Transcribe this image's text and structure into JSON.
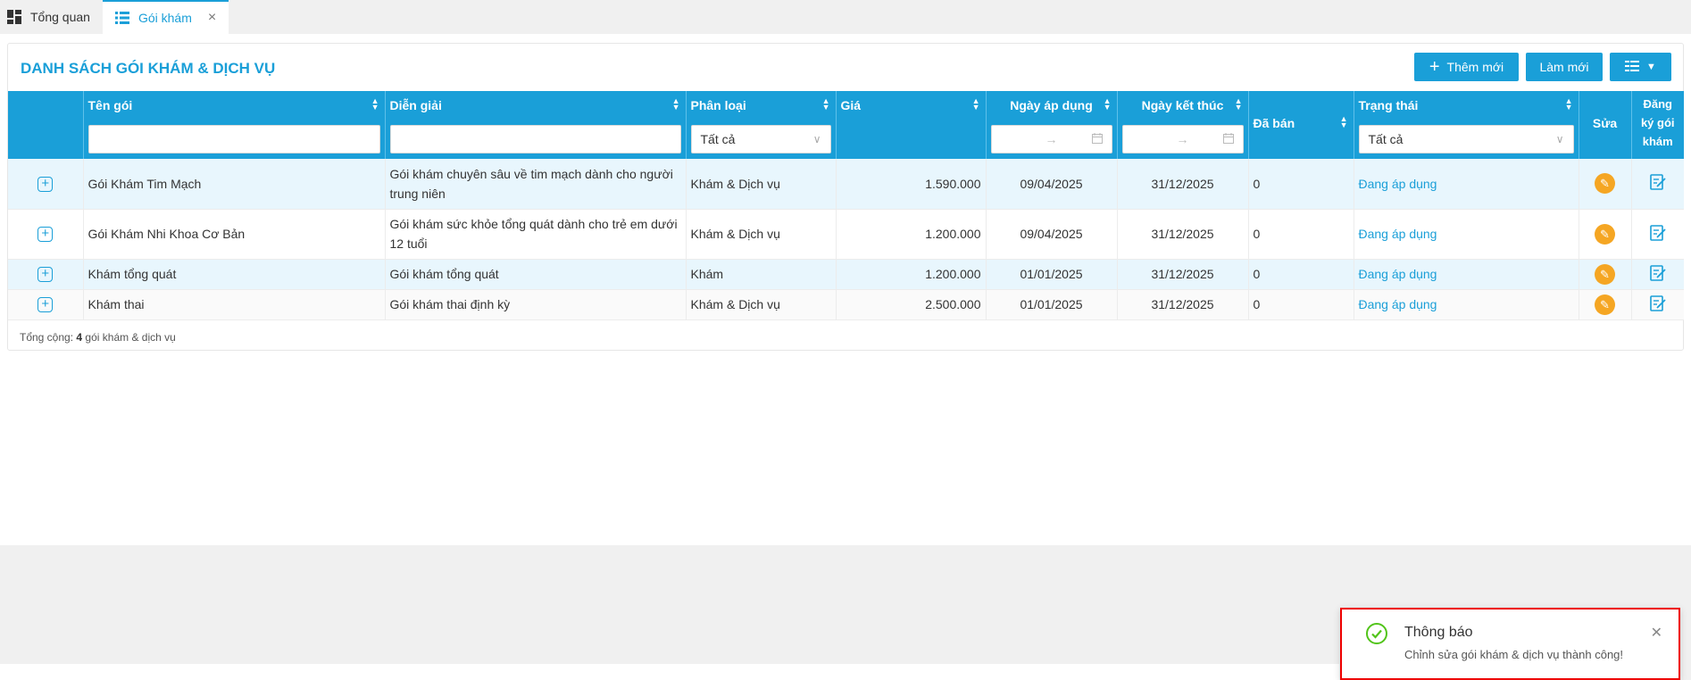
{
  "tabs": [
    {
      "label": "Tổng quan"
    },
    {
      "label": "Gói khám"
    }
  ],
  "card": {
    "title": "DANH SÁCH GÓI KHÁM & DỊCH VỤ",
    "add_label": "Thêm mới",
    "refresh_label": "Làm mới"
  },
  "table": {
    "headers": {
      "name": "Tên gói",
      "desc": "Diễn giải",
      "category": "Phân loại",
      "price": "Giá",
      "start": "Ngày áp dụng",
      "end": "Ngày kết thúc",
      "sold": "Đã bán",
      "status": "Trạng thái",
      "edit": "Sửa",
      "register_1": "Đăng",
      "register_2": "ký gói",
      "register_3": "khám"
    },
    "filters": {
      "category_value": "Tất cả",
      "status_value": "Tất cả",
      "date_sep": "→"
    },
    "rows": [
      {
        "name": "Gói Khám Tim Mạch",
        "desc_1": "Gói khám chuyên sâu về tim mạch dành cho người",
        "desc_2": "trung niên",
        "category": "Khám & Dịch vụ",
        "price": "1.590.000",
        "start": "09/04/2025",
        "end": "31/12/2025",
        "sold": "0",
        "status": "Đang áp dụng"
      },
      {
        "name": "Gói Khám Nhi Khoa Cơ Bản",
        "desc_1": "Gói khám sức khỏe tổng quát dành cho trẻ em dưới",
        "desc_2": "12 tuổi",
        "category": "Khám & Dịch vụ",
        "price": "1.200.000",
        "start": "09/04/2025",
        "end": "31/12/2025",
        "sold": "0",
        "status": "Đang áp dụng"
      },
      {
        "name": "Khám tổng quát",
        "desc_1": "Gói khám tổng quát",
        "desc_2": "",
        "category": "Khám",
        "price": "1.200.000",
        "start": "01/01/2025",
        "end": "31/12/2025",
        "sold": "0",
        "status": "Đang áp dụng"
      },
      {
        "name": "Khám thai",
        "desc_1": "Gói khám thai định kỳ",
        "desc_2": "",
        "category": "Khám & Dịch vụ",
        "price": "2.500.000",
        "start": "01/01/2025",
        "end": "31/12/2025",
        "sold": "0",
        "status": "Đang áp dụng"
      }
    ]
  },
  "footer": {
    "total_prefix": "Tổng cộng:",
    "total_count": "4",
    "total_suffix": "gói khám & dịch vụ"
  },
  "toast": {
    "title": "Thông báo",
    "message": "Chỉnh sửa gói khám & dịch vụ thành công!"
  },
  "colors": {
    "primary": "#1a9fd8",
    "edit": "#f5a623",
    "success": "#52c41a",
    "highlight_border": "#e00000"
  }
}
